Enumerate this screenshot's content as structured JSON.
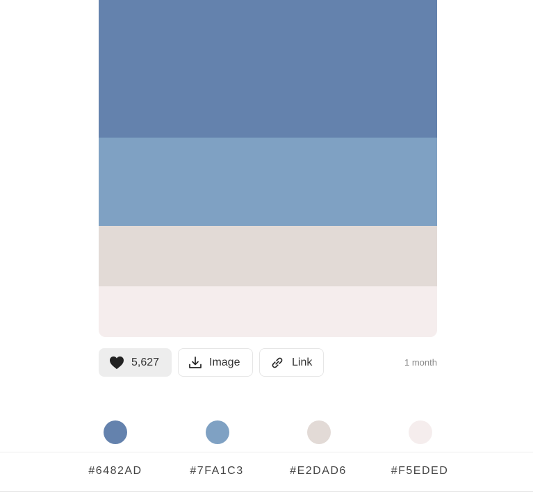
{
  "palette": {
    "colors": [
      "#6482AD",
      "#7FA1C3",
      "#E2DAD6",
      "#F5EDED"
    ]
  },
  "actions": {
    "likes": "5,627",
    "image_label": "Image",
    "link_label": "Link",
    "age": "1 month"
  },
  "hex_codes": [
    "#6482AD",
    "#7FA1C3",
    "#E2DAD6",
    "#F5EDED"
  ],
  "icons": {
    "like": "heart-icon",
    "image": "download-icon",
    "link": "link-icon"
  }
}
